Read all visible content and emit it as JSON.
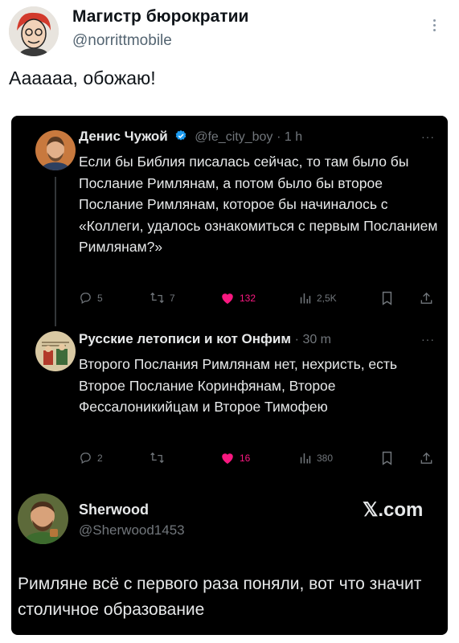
{
  "outer": {
    "name": "Магистр бюрократии",
    "handle": "@norrittmobile",
    "text": "Аааааа, обожаю!"
  },
  "tweets": [
    {
      "name": "Денис Чужой",
      "handle": "@fe_city_boy",
      "time": "1 h",
      "text": "Если бы Библия писалась сейчас, то там было бы Послание Римлянам, а потом было бы второе Послание Римлянам, которое бы начиналось с «Коллеги, удалось ознакомиться с первым Посланием Римлянам?»",
      "replies": "5",
      "retweets": "7",
      "likes": "132",
      "views": "2,5K"
    },
    {
      "name": "Русские летописи и кот Онфим",
      "handle": "",
      "time": "30 m",
      "text": "Второго Послания Римлянам нет, нехристь, есть Второе Послание Коринфянам, Второе Фессалоникийцам и Второе Тимофею",
      "replies": "2",
      "retweets": "",
      "likes": "16",
      "views": "380"
    }
  ],
  "bottom": {
    "name": "Sherwood",
    "handle": "@Sherwood1453",
    "brand": "𝕏.com",
    "text": "Римляне всё с первого раза поняли, вот что значит столичное образование"
  },
  "colors": {
    "like": "#f91880",
    "verified": "#1d9bf0",
    "muted": "#71767b"
  },
  "icons": [
    "reply-icon",
    "retweet-icon",
    "heart-icon",
    "views-icon",
    "bookmark-icon",
    "share-icon",
    "verified-icon",
    "more-icon"
  ]
}
